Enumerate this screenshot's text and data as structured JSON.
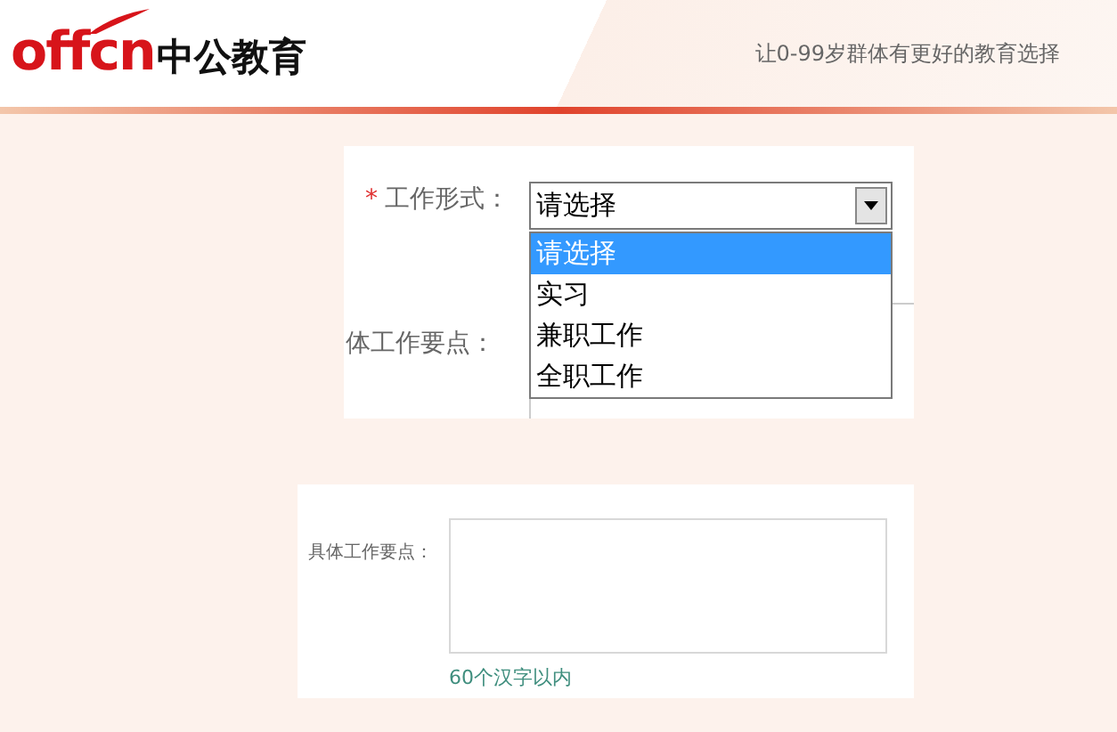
{
  "header": {
    "logo_latin": "offcn",
    "logo_chinese": "中公教育",
    "tagline": "让0-99岁群体有更好的教育选择"
  },
  "form_top": {
    "required_mark": "*",
    "work_type_label": "工作形式：",
    "select_value": "请选择",
    "options": [
      {
        "label": "请选择",
        "selected": true
      },
      {
        "label": "实习",
        "selected": false
      },
      {
        "label": "兼职工作",
        "selected": false
      },
      {
        "label": "全职工作",
        "selected": false
      }
    ],
    "points_label": "体工作要点："
  },
  "form_bottom": {
    "points_label": "具体工作要点：",
    "hint": "60个汉字以内"
  }
}
